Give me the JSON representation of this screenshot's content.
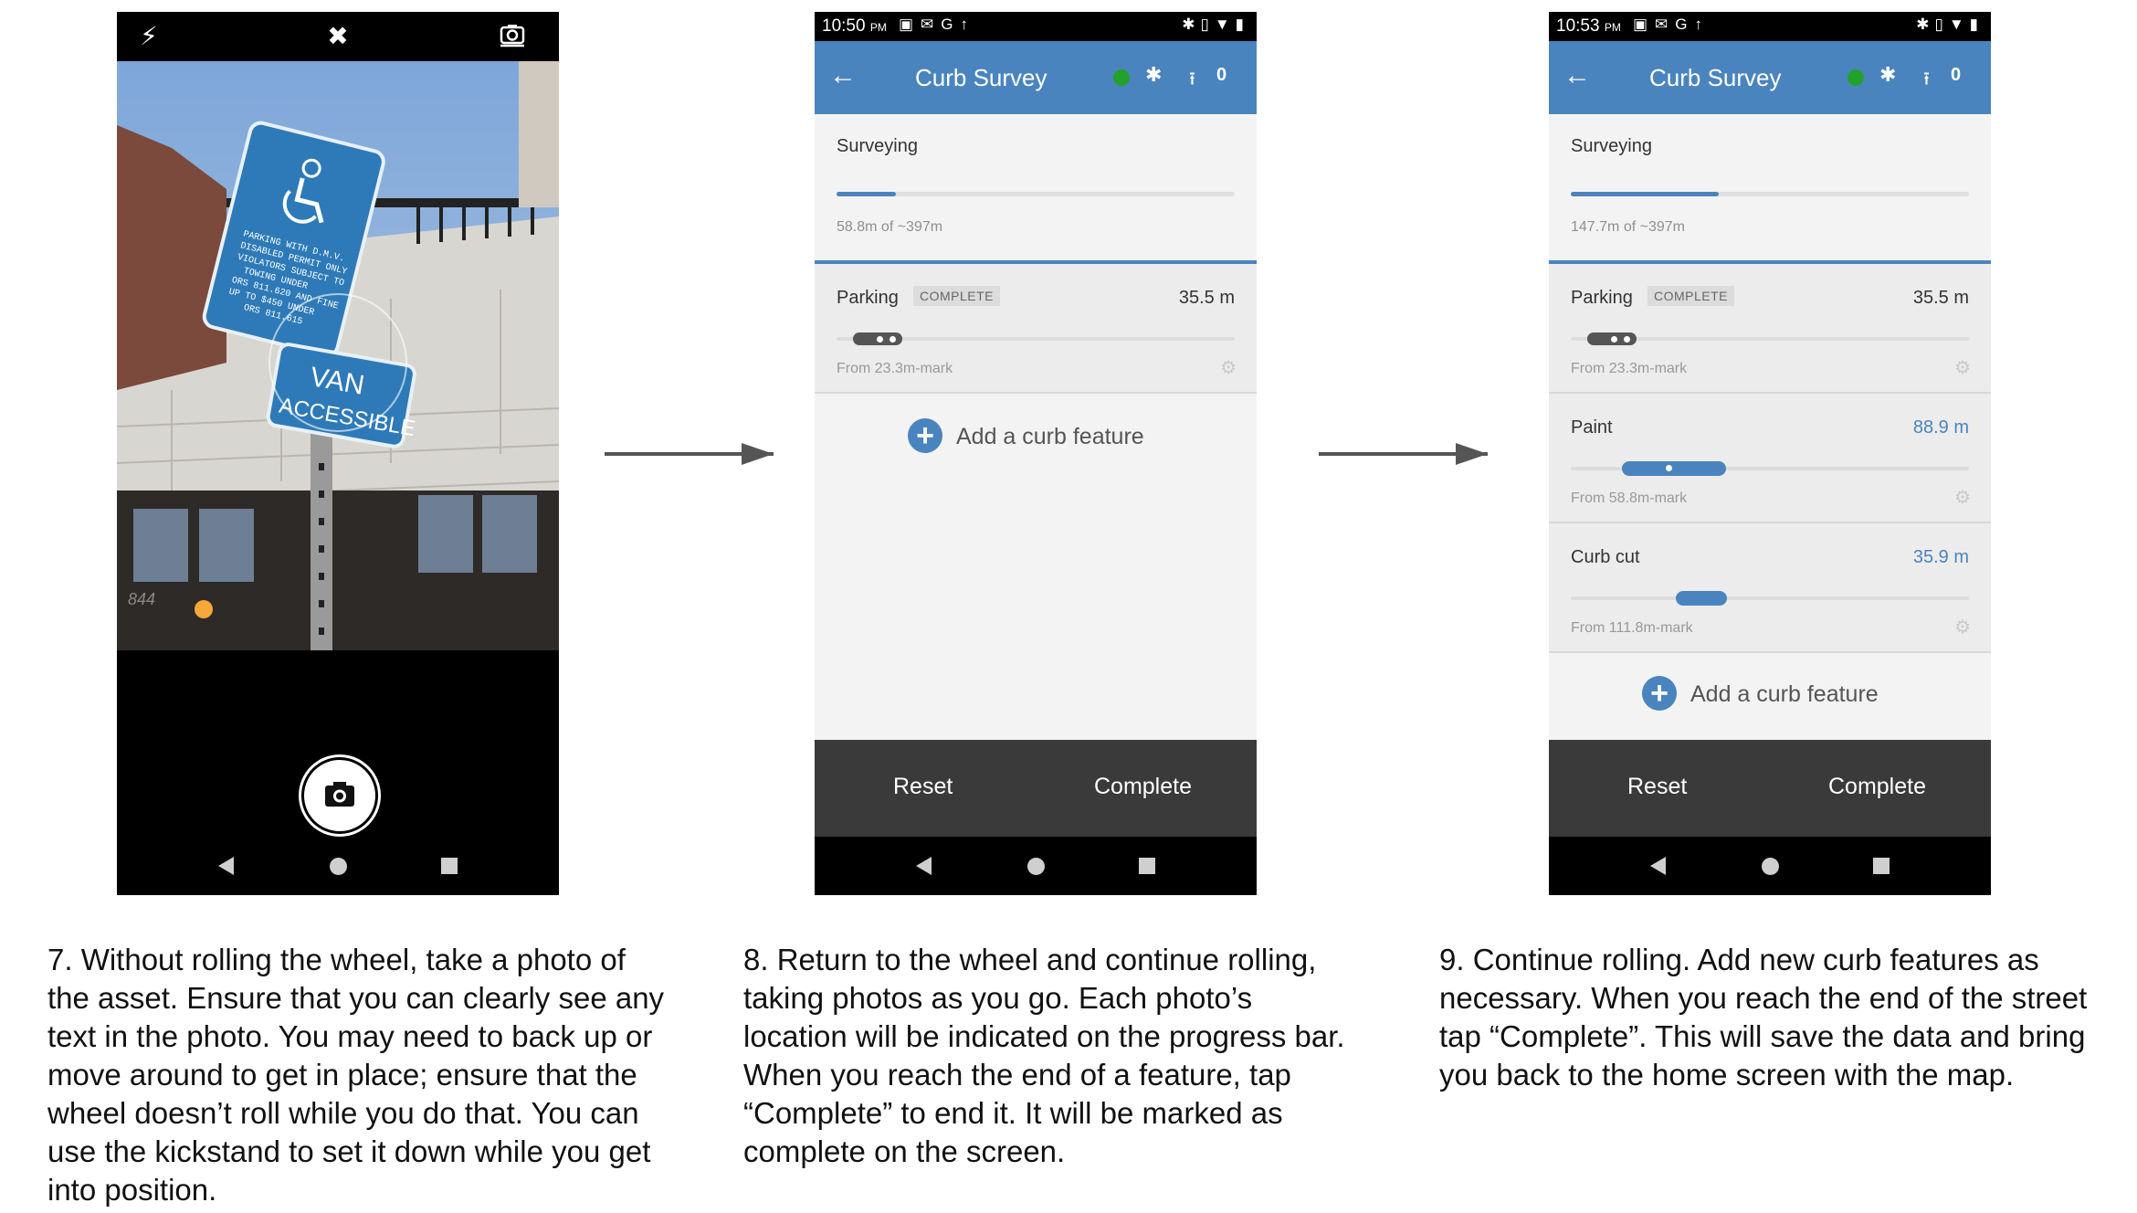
{
  "step7": {
    "caption": "7. Without rolling the wheel, take a photo of the asset. Ensure that you can clearly see any text in the photo. You may need to back up or move around to get in place; ensure that the wheel doesn’t roll while you do that. You can use the kickstand to set it down while you get into position.",
    "camera": {
      "icons": [
        "flash-icon",
        "flash-off-icon",
        "switch-camera-icon",
        "camera-shutter-icon"
      ],
      "sign_top_text": "PARKING WITH D.M.V. DISABLED PERMIT ONLY VIOLATORS SUBJECT TO TOWING UNDER ORS 811.620 AND FINE UP TO $450 UNDER ORS 811.615",
      "sign_bottom_text": "VAN ACCESSIBLE",
      "building_number": "844"
    }
  },
  "step8": {
    "caption": "8. Return to the wheel and continue rolling, taking photos as you go. Each photo’s location will be indicated on the progress bar.  When you reach the end of a feature, tap “Complete” to end it. It will be marked as complete on the screen.",
    "status_time": "10:50",
    "status_ampm": "PM",
    "app_title": "Curb Survey",
    "upload_count": "0",
    "surveying_label": "Surveying",
    "surveying_distance": "58.8m of ~397m",
    "surveying_progress": 0.148,
    "features": [
      {
        "name": "Parking",
        "badge": "COMPLETE",
        "length": "35.5 m",
        "from": "From 23.3m-mark"
      }
    ],
    "add_feature": "Add a curb feature",
    "reset": "Reset",
    "complete": "Complete"
  },
  "step9": {
    "caption": "9. Continue rolling. Add new curb features as necessary. When you reach the end of the street tap “Complete”. This will save the data and bring you back to the home screen with the map.",
    "status_time": "10:53",
    "status_ampm": "PM",
    "app_title": "Curb Survey",
    "upload_count": "0",
    "surveying_label": "Surveying",
    "surveying_distance": "147.7m of ~397m",
    "surveying_progress": 0.372,
    "features": [
      {
        "name": "Parking",
        "badge": "COMPLETE",
        "length": "35.5 m",
        "from": "From 23.3m-mark"
      },
      {
        "name": "Paint",
        "badge": "",
        "length": "88.9 m",
        "from": "From 58.8m-mark"
      },
      {
        "name": "Curb cut",
        "badge": "",
        "length": "35.9 m",
        "from": "From 111.8m-mark"
      }
    ],
    "add_feature": "Add a curb feature",
    "reset": "Reset",
    "complete": "Complete"
  },
  "colors": {
    "app_blue": "#4a84bf",
    "status_green": "#23a12c",
    "bottom_bar": "#3a3a3a"
  }
}
